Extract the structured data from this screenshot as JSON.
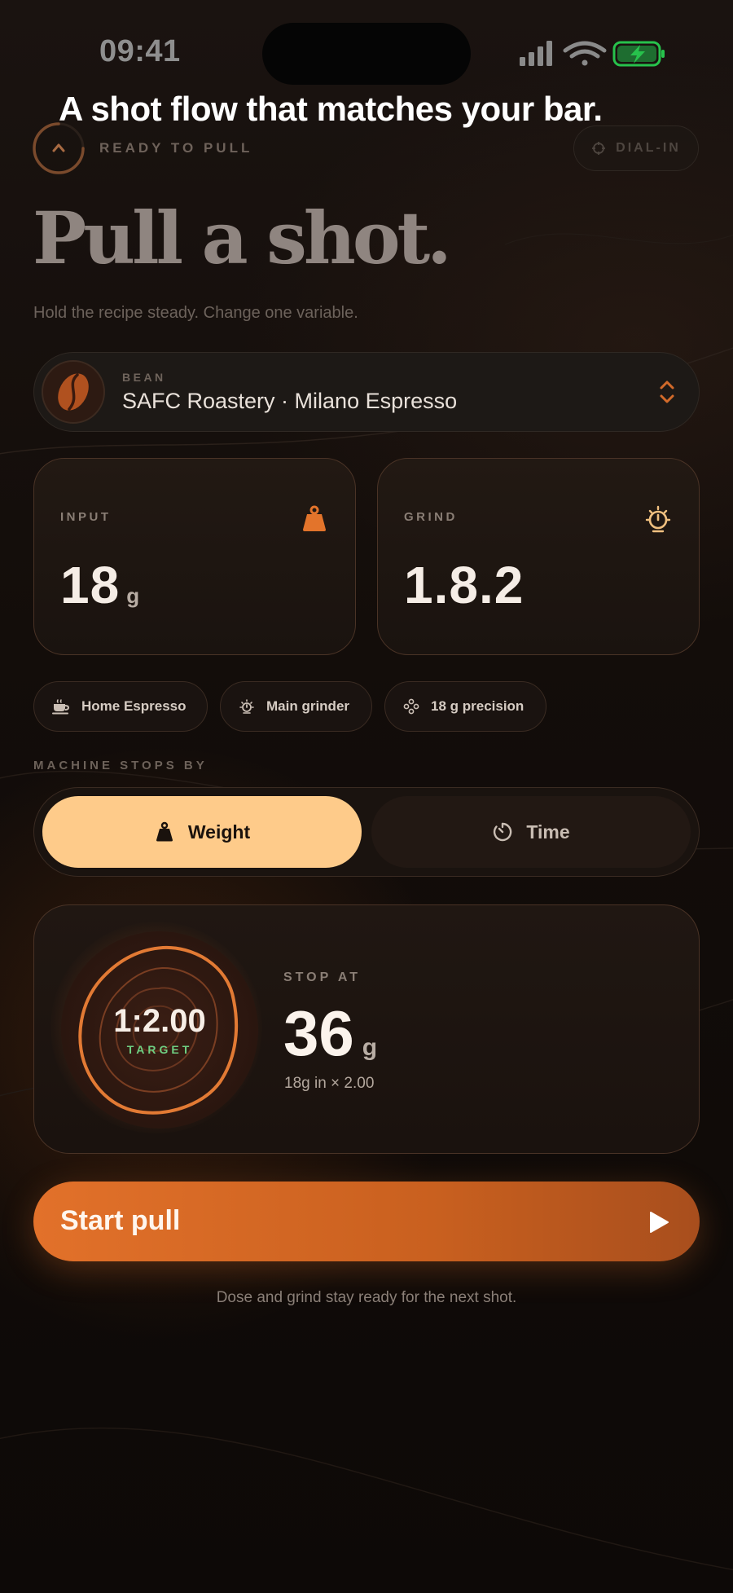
{
  "status_bar": {
    "time": "09:41",
    "icons": [
      "signal-icon",
      "wifi-icon",
      "battery-charging-icon"
    ],
    "battery_color": "#27c24c"
  },
  "headline": "A shot flow that matches your bar.",
  "header": {
    "ready_label": "READY TO PULL",
    "dialin_label": "DIAL-IN"
  },
  "title": "Pull a shot.",
  "subtitle": "Hold the recipe steady. Change one variable.",
  "bean": {
    "label": "BEAN",
    "name": "SAFC Roastery · Milano Espresso"
  },
  "input": {
    "label": "INPUT",
    "value": "18",
    "unit": "g"
  },
  "grind": {
    "label": "GRIND",
    "value": "1.8.2"
  },
  "chips": [
    {
      "label": "Home Espresso",
      "icon": "cup-icon"
    },
    {
      "label": "Main grinder",
      "icon": "grinder-icon"
    },
    {
      "label": "18 g precision",
      "icon": "precision-icon"
    }
  ],
  "machine_stops": {
    "label": "MACHINE STOPS BY",
    "options": [
      "Weight",
      "Time"
    ],
    "selected": "Weight"
  },
  "target": {
    "ratio": "1:2.00",
    "tag": "TARGET",
    "stop_label": "STOP AT",
    "stop_value": "36",
    "stop_unit": "g",
    "formula": "18g in × 2.00"
  },
  "start": {
    "label": "Start pull"
  },
  "footer_note": "Dose and grind stay ready for the next shot.",
  "colors": {
    "accent": "#e2712a",
    "accent_soft": "#fecb8a",
    "target_green": "#6fcf82",
    "background": "#130d0a"
  }
}
